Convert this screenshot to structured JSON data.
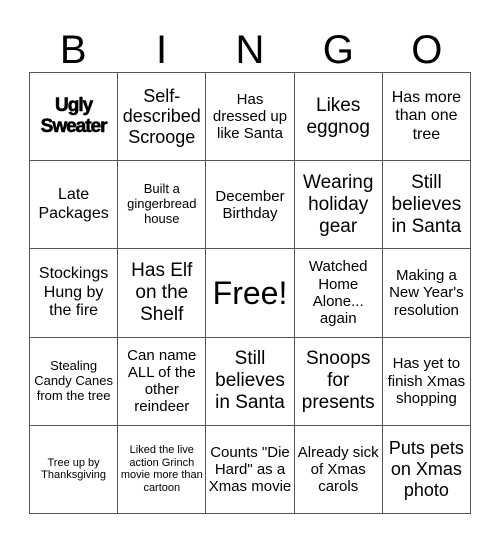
{
  "header": {
    "letters": [
      "B",
      "I",
      "N",
      "G",
      "O"
    ]
  },
  "cells": [
    "Ugly Sweater",
    "Self-described Scrooge",
    "Has dressed up like Santa",
    "Likes eggnog",
    "Has more than one tree",
    "Late Packages",
    "Built a gingerbread house",
    "December Birthday",
    "Wearing holiday gear",
    "Still believes in Santa",
    "Stockings Hung by the fire",
    "Has Elf on the Shelf",
    "Free!",
    "Watched Home Alone... again",
    "Making a New Year's resolution",
    "Stealing Candy Canes from the tree",
    "Can name ALL of the other reindeer",
    "Still believes in Santa",
    "Snoops for presents",
    "Has yet to finish Xmas shopping",
    "Tree up by Thanksgiving",
    "Liked the live action Grinch movie more than cartoon",
    "Counts \"Die Hard\" as a Xmas movie",
    "Already sick of Xmas carols",
    "Puts pets on Xmas photo"
  ]
}
